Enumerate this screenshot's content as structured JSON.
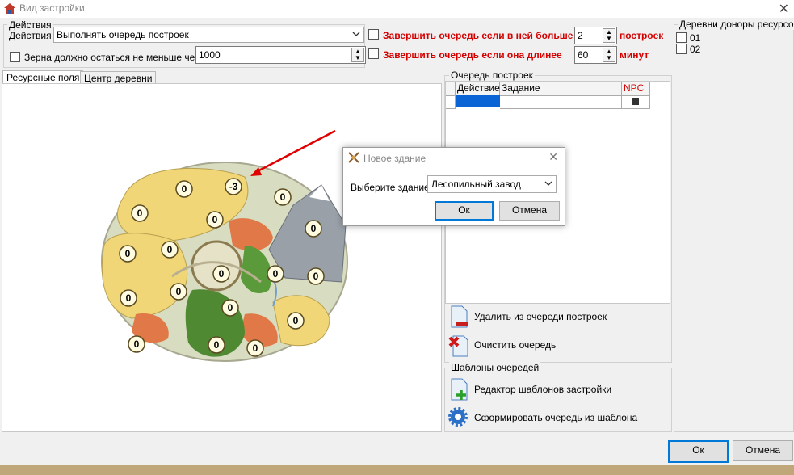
{
  "window": {
    "title": "Вид застройки"
  },
  "actions": {
    "group_label": "Действия",
    "label": "Действия",
    "selected": "Выполнять очередь построек",
    "grain_label": "Зерна должно остаться не меньше чем",
    "grain_value": "1000"
  },
  "finish": {
    "more_label": "Завершить очередь если в ней больше",
    "more_value": "2",
    "more_unit": "построек",
    "longer_label": "Завершить очередь если она длинее",
    "longer_value": "60",
    "longer_unit": "минут"
  },
  "donors": {
    "title": "Деревни доноры ресурсов",
    "items": [
      "01",
      "02"
    ]
  },
  "tabs": [
    "Ресурсные поля",
    "Центр деревни"
  ],
  "map": {
    "fields": [
      "0",
      "-3",
      "0",
      "0",
      "0",
      "0",
      "0",
      "0",
      "0",
      "0",
      "0",
      "0",
      "0",
      "0",
      "0",
      "0",
      "0",
      "0"
    ]
  },
  "queue": {
    "title": "Очередь построек",
    "columns": [
      "Действие",
      "Задание",
      "NPC"
    ],
    "delete_label": "Удалить из очереди построек",
    "clear_label": "Очистить очередь"
  },
  "templates": {
    "title": "Шаблоны очередей",
    "editor_label": "Редактор шаблонов застройки",
    "form_label": "Сформировать очередь из шаблона"
  },
  "dialog": {
    "title": "Новое здание",
    "choose_label": "Выберите здание",
    "selected": "Лесопильный завод",
    "ok": "Ок",
    "cancel": "Отмена"
  },
  "footer": {
    "ok": "Ок",
    "cancel": "Отмена"
  },
  "colors": {
    "accent": "#0078d7",
    "alert": "#d40000",
    "selection": "#0a64d6"
  }
}
